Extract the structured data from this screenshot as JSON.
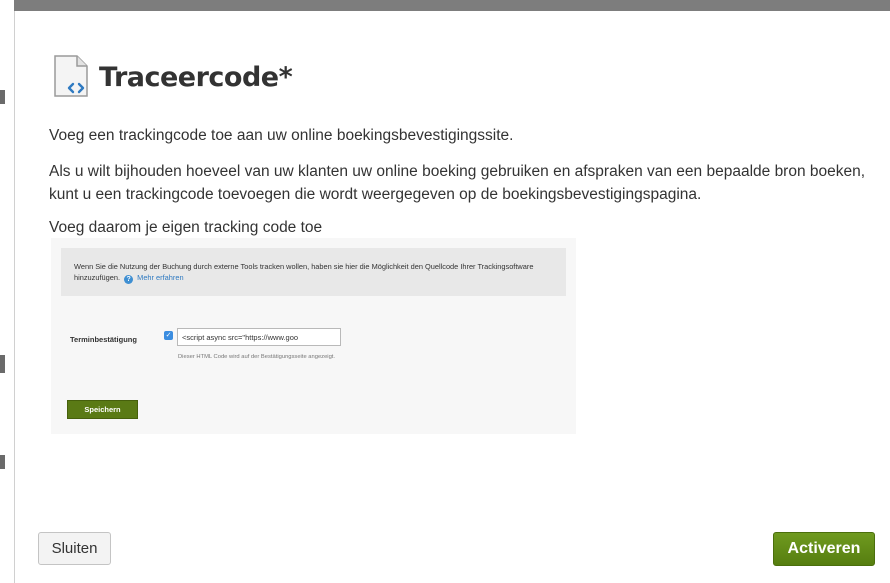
{
  "dialog": {
    "title": "Traceercode*",
    "intro": "Voeg een trackingcode toe aan uw online boekingsbevestigingssite.",
    "description": "Als u wilt bijhouden hoeveel van uw klanten uw online boeking gebruiken en afspraken van een bepaalde bron boeken, kunt u een trackingcode toevoegen die wordt weergegeven op de boekingsbevestigingspagina.",
    "instruction": "Voeg daarom je eigen tracking code toe",
    "title_icon": "document-code-icon"
  },
  "example": {
    "notice_text": "Wenn Sie die Nutzung der Buchung durch externe Tools tracken wollen, haben sie hier die Möglichkeit den Quellcode Ihrer Trackingsoftware hinzuzufügen.",
    "help_icon": "?",
    "more_link": "Mehr erfahren",
    "field_label": "Terminbestätigung",
    "checkbox_mark": "✓",
    "input_value": "<script async src=\"https://www.goo",
    "hint": "Dieser HTML Code wird auf der Bestätigungsseite angezeigt.",
    "save_label": "Speichern"
  },
  "footer": {
    "close_label": "Sluiten",
    "activate_label": "Activeren"
  },
  "colors": {
    "accent_green": "#5f8a14",
    "link_blue": "#2f7ac1"
  }
}
